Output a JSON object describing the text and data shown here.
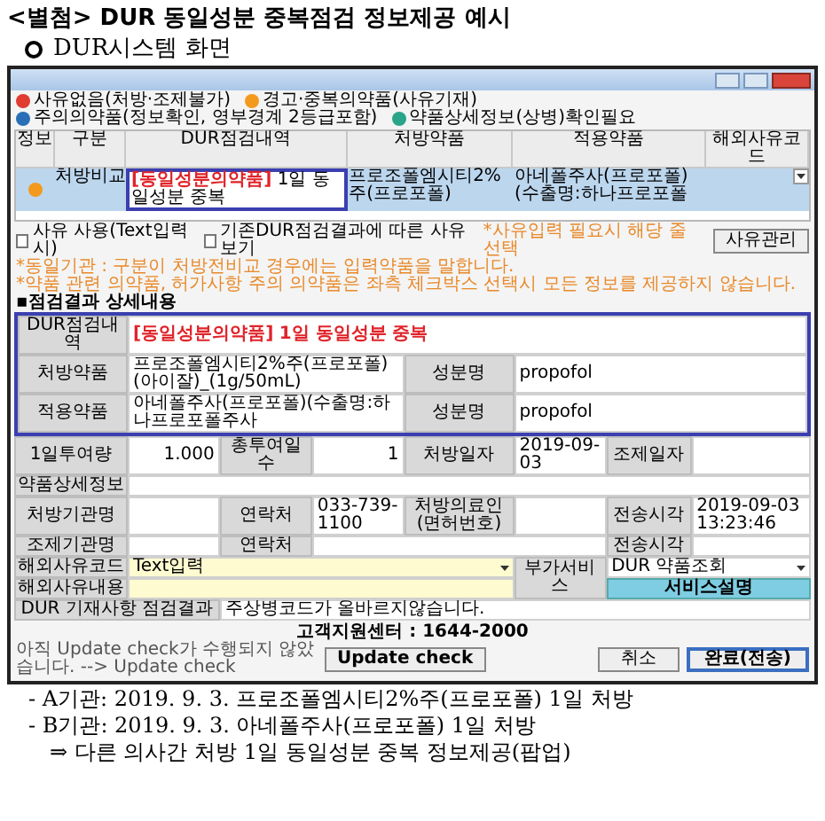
{
  "doc_title": "<별첨> DUR 동일성분 중복점검 정보제공 예시",
  "section": "DUR시스템 화면",
  "window": {
    "legend": [
      {
        "label": "사유없음(처방·조제불가)",
        "color": "#e03c31"
      },
      {
        "label": "경고·중복의약품(사유기재)",
        "color": "#f39a1e"
      },
      {
        "label": "주의의약품(정보확인, 영부경계 2등급포함)",
        "color": "#2a6fb5"
      },
      {
        "label": "약품상세정보(상병)확인필요",
        "color": "#2aa58a"
      }
    ],
    "table": {
      "columns": [
        "정보",
        "구분",
        "DUR점검내역",
        "처방약품",
        "적용약품",
        "해외사유코드"
      ],
      "rows": [
        {
          "color": "#f39a1e",
          "selected": true,
          "type": "처방비교",
          "tag": "[동일성분의약품]",
          "finding": "1일 동일성분 중복",
          "prescribed": "프로조폴엠시티2%주(프로포폴)",
          "applied": "아네폴주사(프로포폴)(수출명:하나프로포폴"
        }
      ]
    },
    "checkboxes": [
      {
        "label": "사유 사용(Text입력시)",
        "checked": false
      },
      {
        "label": "기존DUR점검결과에 따른 사유보기",
        "checked": false
      }
    ],
    "hint": "*사유입력 필요시 해당 줄 선택",
    "reason_button": "사유관리",
    "notes": [
      "*동일기관 : 구분이 처방전비교 경우에는 입력약품을 말합니다.",
      "*약품 관련 의약품, 허가사항 주의 의약품은 좌측 체크박스 선택시 모든 정보를 제공하지 않습니다."
    ],
    "detail": {
      "title": "▪점검결과 상세내용",
      "finding": {
        "label": "DUR점검내역",
        "tag": "[동일성분의약품]",
        "text": "1일 동일성분 중복"
      },
      "prescribed": {
        "label": "처방약품",
        "value": "프로조폴엠시티2%주(프로포폴)(아이잘)_(1g/50mL)",
        "ingredient_label": "성분명",
        "ingredient": "propofol"
      },
      "applied": {
        "label": "적용약품",
        "value": "아네폴주사(프로포폴)(수출명:하나프로포폴주사",
        "ingredient_label": "성분명",
        "ingredient": "propofol"
      },
      "dose": [
        {
          "label": "1일투여량",
          "value": "1.000"
        },
        {
          "label": "총투여일수",
          "value": "1"
        },
        {
          "label": "처방일자",
          "value": "2019-09-03"
        },
        {
          "label": "조제일자"
        }
      ],
      "drug_info_label": "약품상세정보",
      "rx_org": [
        {
          "label": "처방기관명"
        },
        {
          "label": "연락처",
          "value": "033-739-1100"
        },
        {
          "label": "처방의료인(면허번호)"
        },
        {
          "label": "전송시각",
          "value": "2019-09-03 13:23:46"
        }
      ],
      "disp_org": [
        {
          "label": "조제기관명"
        },
        {
          "label": "연락처"
        },
        {
          "label": "전송시각"
        }
      ],
      "reason_code": {
        "label": "해외사유코드",
        "value": "Text입력"
      },
      "reason_text": {
        "label": "해외사유내용"
      },
      "extra": {
        "label": "부가서비스",
        "value": "DUR 약품조회",
        "button": "서비스설명"
      },
      "check": {
        "label": "DUR 기재사항 점검결과",
        "value": "주상병코드가 올바르지않습니다."
      }
    },
    "support": "고객지원센터 : 1644-2000",
    "update_note": "아직 Update check가 수행되지 않았습니다. --> Update check",
    "buttons": [
      "Update check",
      "취소",
      "완료(전송)"
    ]
  },
  "lines": [
    "- A기관: 2019. 9. 3. 프로조폴엠시티2%주(프로포폴) 1일 처방",
    "- B기관: 2019. 9. 3. 아네폴주사(프로포폴) 1일 처방",
    "⇒ 다른 의사간 처방 1일 동일성분 중복 정보제공(팝업)"
  ]
}
